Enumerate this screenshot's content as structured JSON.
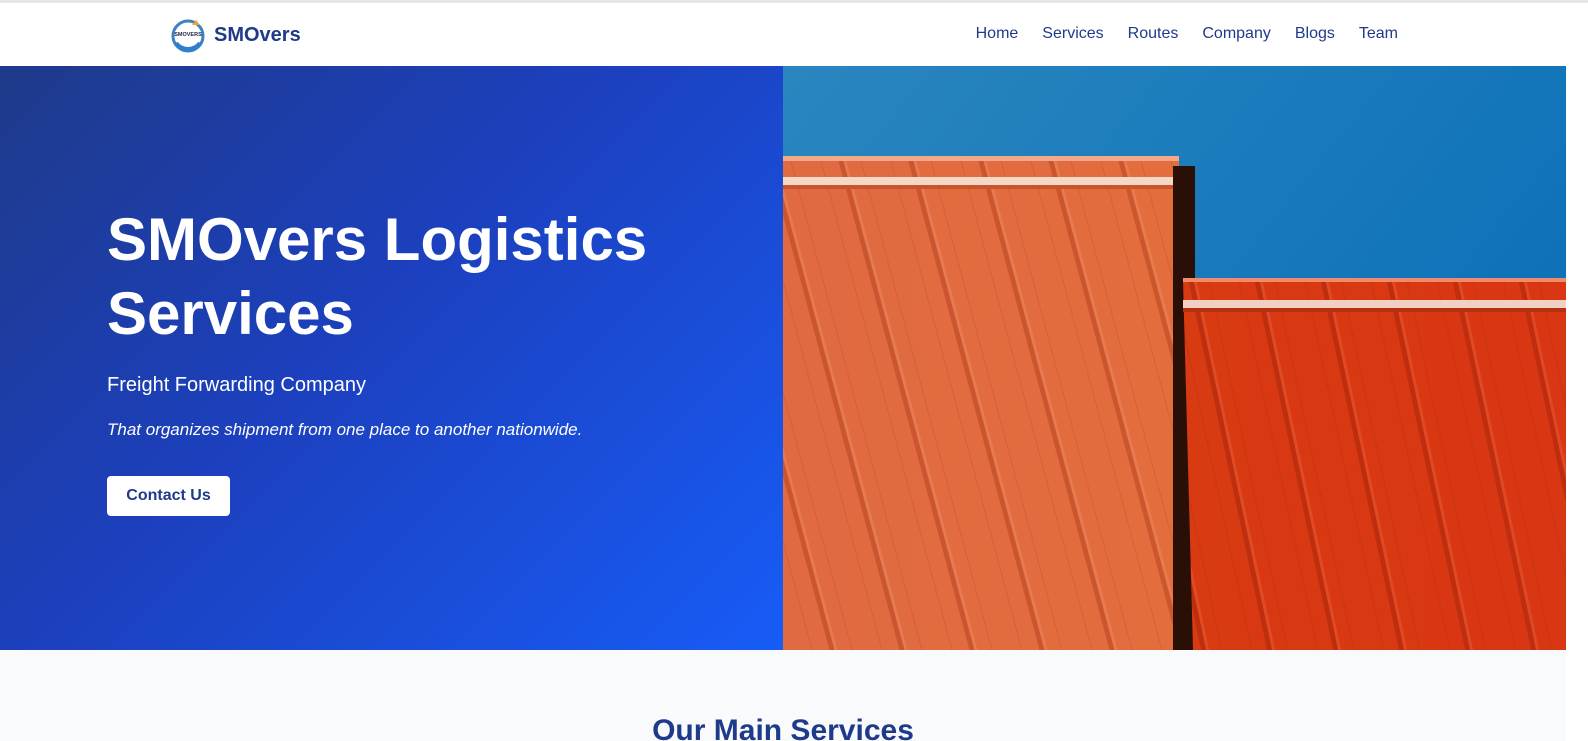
{
  "brand": {
    "name": "SMOvers",
    "logo_icon": "truck-logo-icon",
    "logo_text": "SMOVERS"
  },
  "nav": {
    "items": [
      {
        "label": "Home"
      },
      {
        "label": "Services"
      },
      {
        "label": "Routes"
      },
      {
        "label": "Company"
      },
      {
        "label": "Blogs"
      },
      {
        "label": "Team"
      }
    ]
  },
  "hero": {
    "title": "SMOvers Logistics Services",
    "subtitle": "Freight Forwarding Company",
    "description": "That organizes shipment from one place to another nationwide.",
    "cta_label": "Contact Us",
    "image": "orange-shipping-containers-photo"
  },
  "services": {
    "title": "Our Main Services"
  },
  "colors": {
    "brand": "#1e3a8a",
    "hero_gradient_start": "#1e3a8a",
    "hero_gradient_end": "#175cf7",
    "container_orange": "#e0663b",
    "sky_blue": "#1a7fc0"
  }
}
